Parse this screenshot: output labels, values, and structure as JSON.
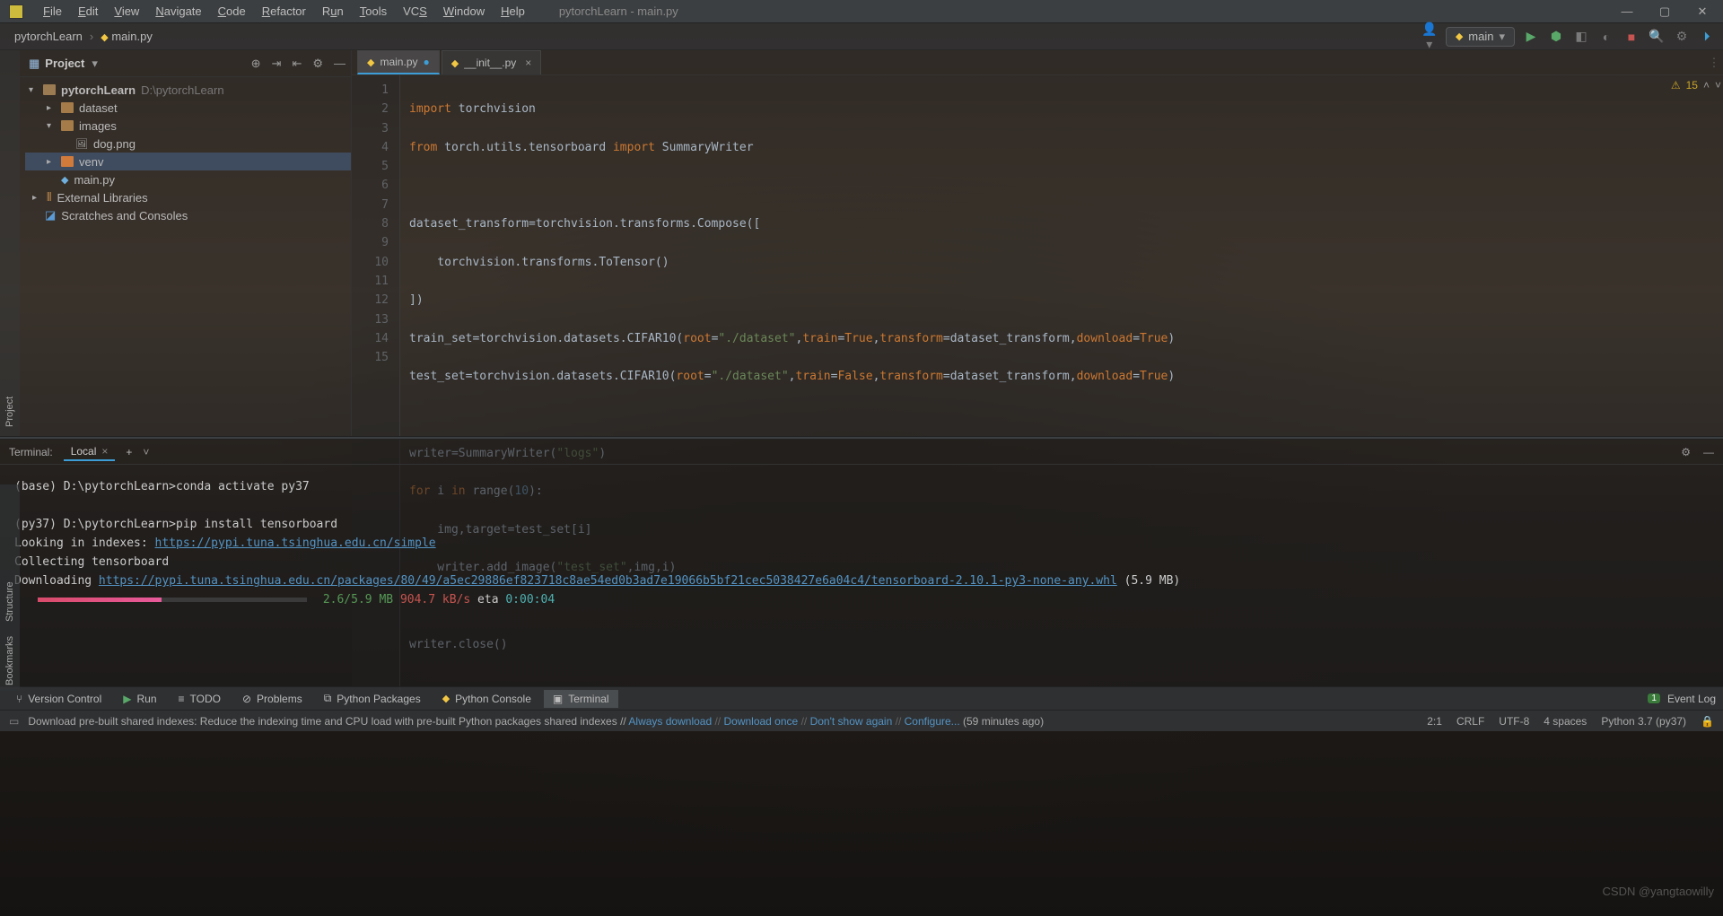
{
  "window": {
    "title": "pytorchLearn - main.py"
  },
  "menu": [
    "File",
    "Edit",
    "View",
    "Navigate",
    "Code",
    "Refactor",
    "Run",
    "Tools",
    "VCS",
    "Window",
    "Help"
  ],
  "breadcrumb": {
    "root": "pytorchLearn",
    "file": "main.py"
  },
  "run_config": {
    "label": "main"
  },
  "project_panel": {
    "title": "Project",
    "root": {
      "name": "pytorchLearn",
      "path": "D:\\pytorchLearn"
    },
    "dataset": "dataset",
    "images": "images",
    "dog": "dog.png",
    "venv": "venv",
    "mainpy": "main.py",
    "extlib": "External Libraries",
    "scratches": "Scratches and Consoles"
  },
  "editor_tabs": [
    {
      "label": "main.py",
      "active": true,
      "dirty": true
    },
    {
      "label": "__init__.py",
      "active": false,
      "dirty": false
    }
  ],
  "inspection": {
    "warn_count": "15"
  },
  "code_lines": [
    "1",
    "2",
    "3",
    "4",
    "5",
    "6",
    "7",
    "8",
    "9",
    "10",
    "11",
    "12",
    "13",
    "14",
    "15"
  ],
  "code": {
    "l1a": "import",
    "l1b": " torchvision",
    "l2a": "from",
    "l2b": " torch.utils.tensorboard ",
    "l2c": "import",
    "l2d": " SummaryWriter",
    "l4": "dataset_transform=torchvision.transforms.Compose([",
    "l5": "    torchvision.transforms.ToTensor()",
    "l6": "])",
    "l7a": "train_set=torchvision.datasets.CIFAR10(",
    "l7r": "root",
    "l7e": "=",
    "l7s": "\"./dataset\"",
    "l7c": ",",
    "l7t": "train",
    "l7e2": "=",
    "l7v": "True",
    "l7c2": ",",
    "l7tf": "transform",
    "l7e3": "=dataset_transform,",
    "l7d": "download",
    "l7e4": "=",
    "l7v2": "True",
    "l7end": ")",
    "l8a": "test_set=torchvision.datasets.CIFAR10(",
    "l8r": "root",
    "l8e": "=",
    "l8s": "\"./dataset\"",
    "l8c": ",",
    "l8t": "train",
    "l8e2": "=",
    "l8v": "False",
    "l8c2": ",",
    "l8tf": "transform",
    "l8e3": "=dataset_transform,",
    "l8d": "download",
    "l8e4": "=",
    "l8v2": "True",
    "l8end": ")",
    "l10a": "writer=SummaryWriter(",
    "l10s": "\"logs\"",
    "l10b": ")",
    "l11a": "for",
    "l11b": " i ",
    "l11c": "in",
    "l11d": " range(",
    "l11n": "10",
    "l11e": "):",
    "l12": "    img,target=test_set[i]",
    "l13a": "    writer.add_image(",
    "l13s": "\"test_set\"",
    "l13b": ",img,i)",
    "l15": "writer.close()"
  },
  "terminal": {
    "label": "Terminal:",
    "tab": "Local",
    "line1": "(base) D:\\pytorchLearn>conda activate py37",
    "line2": "(py37) D:\\pytorchLearn>pip install tensorboard",
    "line3": "Looking in indexes: ",
    "link1": "https://pypi.tuna.tsinghua.edu.cn/simple",
    "line4": "Collecting tensorboard",
    "line5a": "  Downloading ",
    "link2": "https://pypi.tuna.tsinghua.edu.cn/packages/80/49/a5ec29886ef823718c8ae54ed0b3ad7e19066b5bf21cec5038427e6a04c4/tensorboard-2.10.1-py3-none-any.whl",
    "line5b": " (5.9 MB)",
    "progress_pct": 46,
    "size": "2.6/5.9 MB",
    "speed": "904.7 kB/s",
    "eta_lbl": " eta ",
    "eta": "0:00:04"
  },
  "toolwindows": {
    "version_control": "Version Control",
    "run": "Run",
    "todo": "TODO",
    "problems": "Problems",
    "pypkg": "Python Packages",
    "pyconsole": "Python Console",
    "terminal": "Terminal",
    "eventlog": "Event Log",
    "eventcount": "1"
  },
  "status": {
    "msg_a": "Download pre-built shared indexes: Reduce the indexing time and CPU load with pre-built Python packages shared indexes // ",
    "always": "Always download",
    "once": "Download once",
    "dont": "Don't show again",
    "conf": "Configure...",
    "ago": " (59 minutes ago)",
    "pos": "2:1",
    "crlf": "CRLF",
    "enc": "UTF-8",
    "indent": "4 spaces",
    "sdk": "Python 3.7 (py37)"
  },
  "left_tabs": {
    "project": "Project",
    "structure": "Structure",
    "bookmarks": "Bookmarks"
  },
  "watermark": "CSDN @yangtaowilly"
}
